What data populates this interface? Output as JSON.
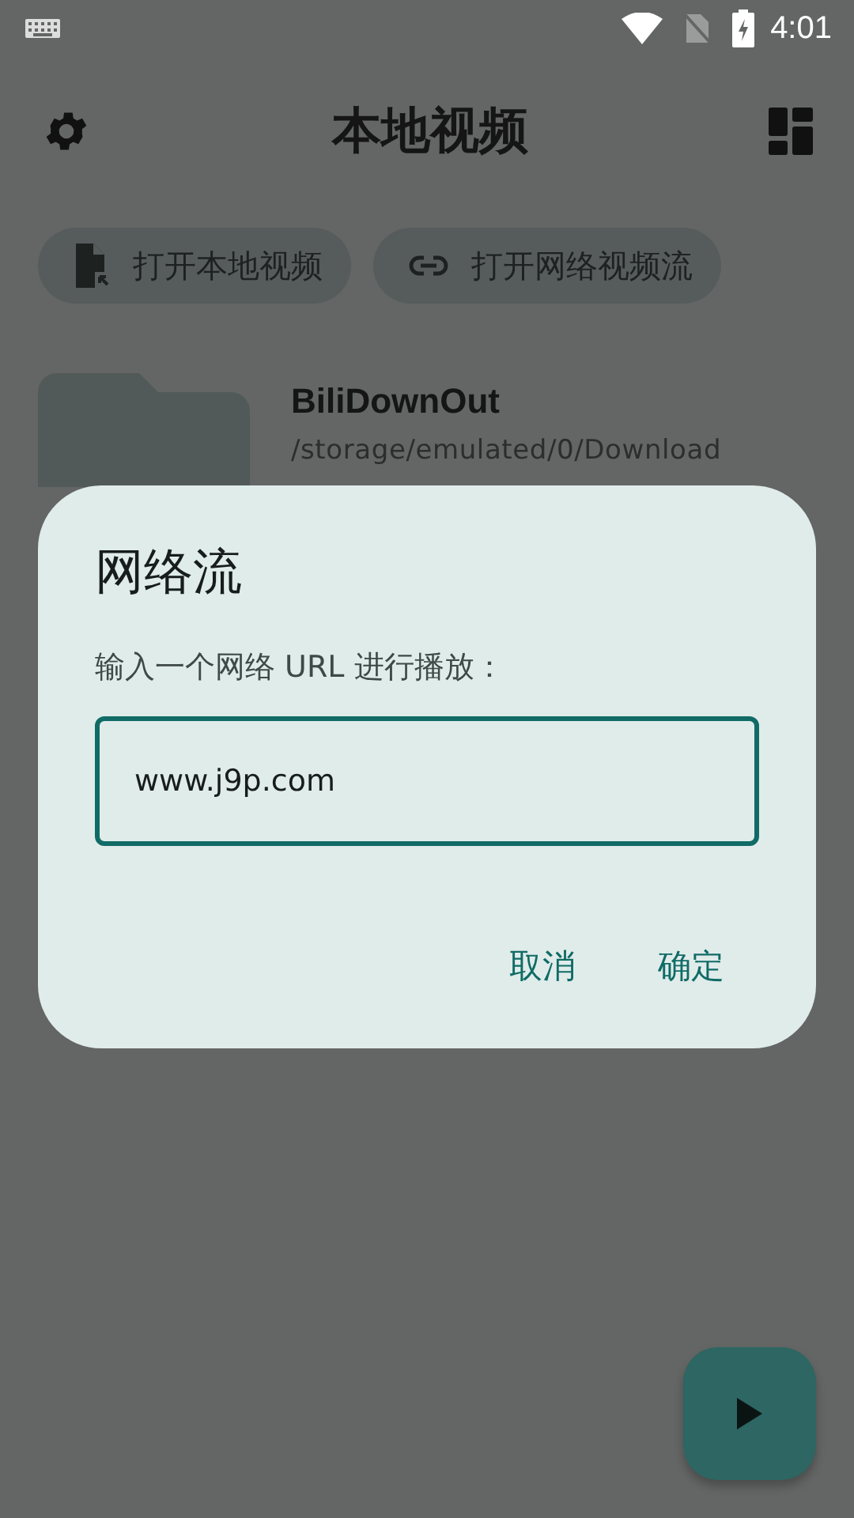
{
  "status_bar": {
    "time": "4:01"
  },
  "app_bar": {
    "title": "本地视频"
  },
  "chips": [
    {
      "kind": "file",
      "label": "打开本地视频"
    },
    {
      "kind": "link",
      "label": "打开网络视频流"
    }
  ],
  "folders": [
    {
      "name": "BiliDownOut",
      "path": "/storage/emulated/0/Download"
    }
  ],
  "dialog": {
    "title": "网络流",
    "message": "输入一个网络 URL 进行播放：",
    "input": {
      "value": "www.j9p.com",
      "focused": true
    },
    "buttons": [
      "取消",
      "确定"
    ]
  }
}
